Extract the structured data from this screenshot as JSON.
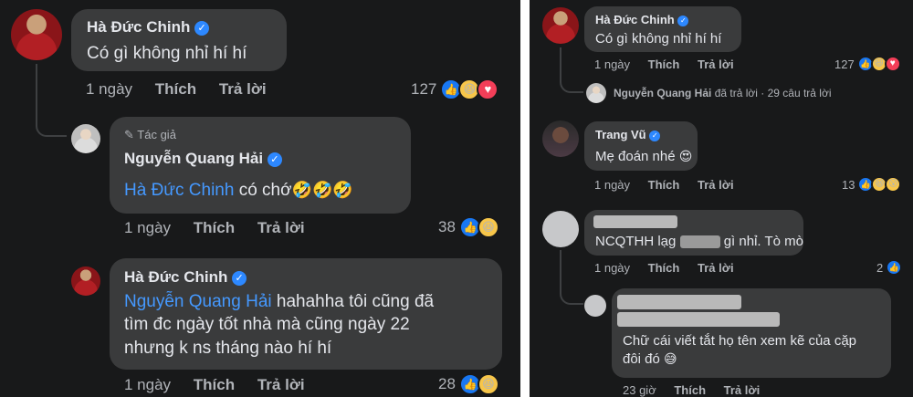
{
  "left": {
    "top_comment": {
      "author": "Hà Đức Chinh",
      "text": "Có gì không nhỉ hí hí",
      "time": "1 ngày",
      "like": "Thích",
      "reply": "Trả lời",
      "reaction_count": "127"
    },
    "reply_1": {
      "badge": "Tác giả",
      "author": "Nguyễn Quang Hải",
      "mention": "Hà Đức Chinh",
      "text": " có chớ",
      "emojis": "🤣🤣🤣",
      "time": "1 ngày",
      "like": "Thích",
      "reply": "Trả lời",
      "reaction_count": "38"
    },
    "reply_2": {
      "author": "Hà Đức Chinh",
      "mention": "Nguyễn Quang Hải",
      "text_line1": " hahahha tôi cũng đã",
      "text_line2": "tìm đc ngày tốt nhà mà cũng ngày 22",
      "text_line3": "nhưng k ns tháng nào hí hí",
      "time": "1 ngày",
      "like": "Thích",
      "reply": "Trả lời",
      "reaction_count": "28"
    }
  },
  "right": {
    "top_comment": {
      "author": "Hà Đức Chinh",
      "text": "Có gì không nhỉ hí hí",
      "time": "1 ngày",
      "like": "Thích",
      "reply": "Trả lời",
      "reaction_count": "127"
    },
    "replies_summary": {
      "author": "Nguyễn Quang Hải",
      "action": "đã trả lời",
      "separator": "·",
      "count": "29 câu trả lời"
    },
    "comment_trang": {
      "author": "Trang Vũ",
      "text": "Mẹ đoán nhé",
      "emoji": "😍",
      "time": "1 ngày",
      "like": "Thích",
      "reply": "Trả lời",
      "reaction_count": "13"
    },
    "comment_anon": {
      "text_before": "NCQTHH lạg",
      "text_after": "gì nhỉ. Tò mò",
      "time": "1 ngày",
      "like": "Thích",
      "reply": "Trả lời",
      "reaction_count": "2"
    },
    "reply_anon": {
      "text_line1": "Chữ cái viết tắt họ tên xem kẽ của cặp",
      "text_line2": "đôi đó",
      "emoji": "😅",
      "time": "23 giờ",
      "like": "Thích",
      "reply": "Trả lời"
    }
  },
  "icons": {
    "verified": "✓",
    "like": "👍",
    "haha": "😆",
    "love": "♥",
    "pencil": "✎",
    "wow": "😮"
  },
  "colors": {
    "background": "#18191a",
    "bubble": "#3a3b3c",
    "text": "#e4e6eb",
    "secondary": "#b0b3b8",
    "mention": "#4599ff",
    "verified": "#2d88ff"
  }
}
